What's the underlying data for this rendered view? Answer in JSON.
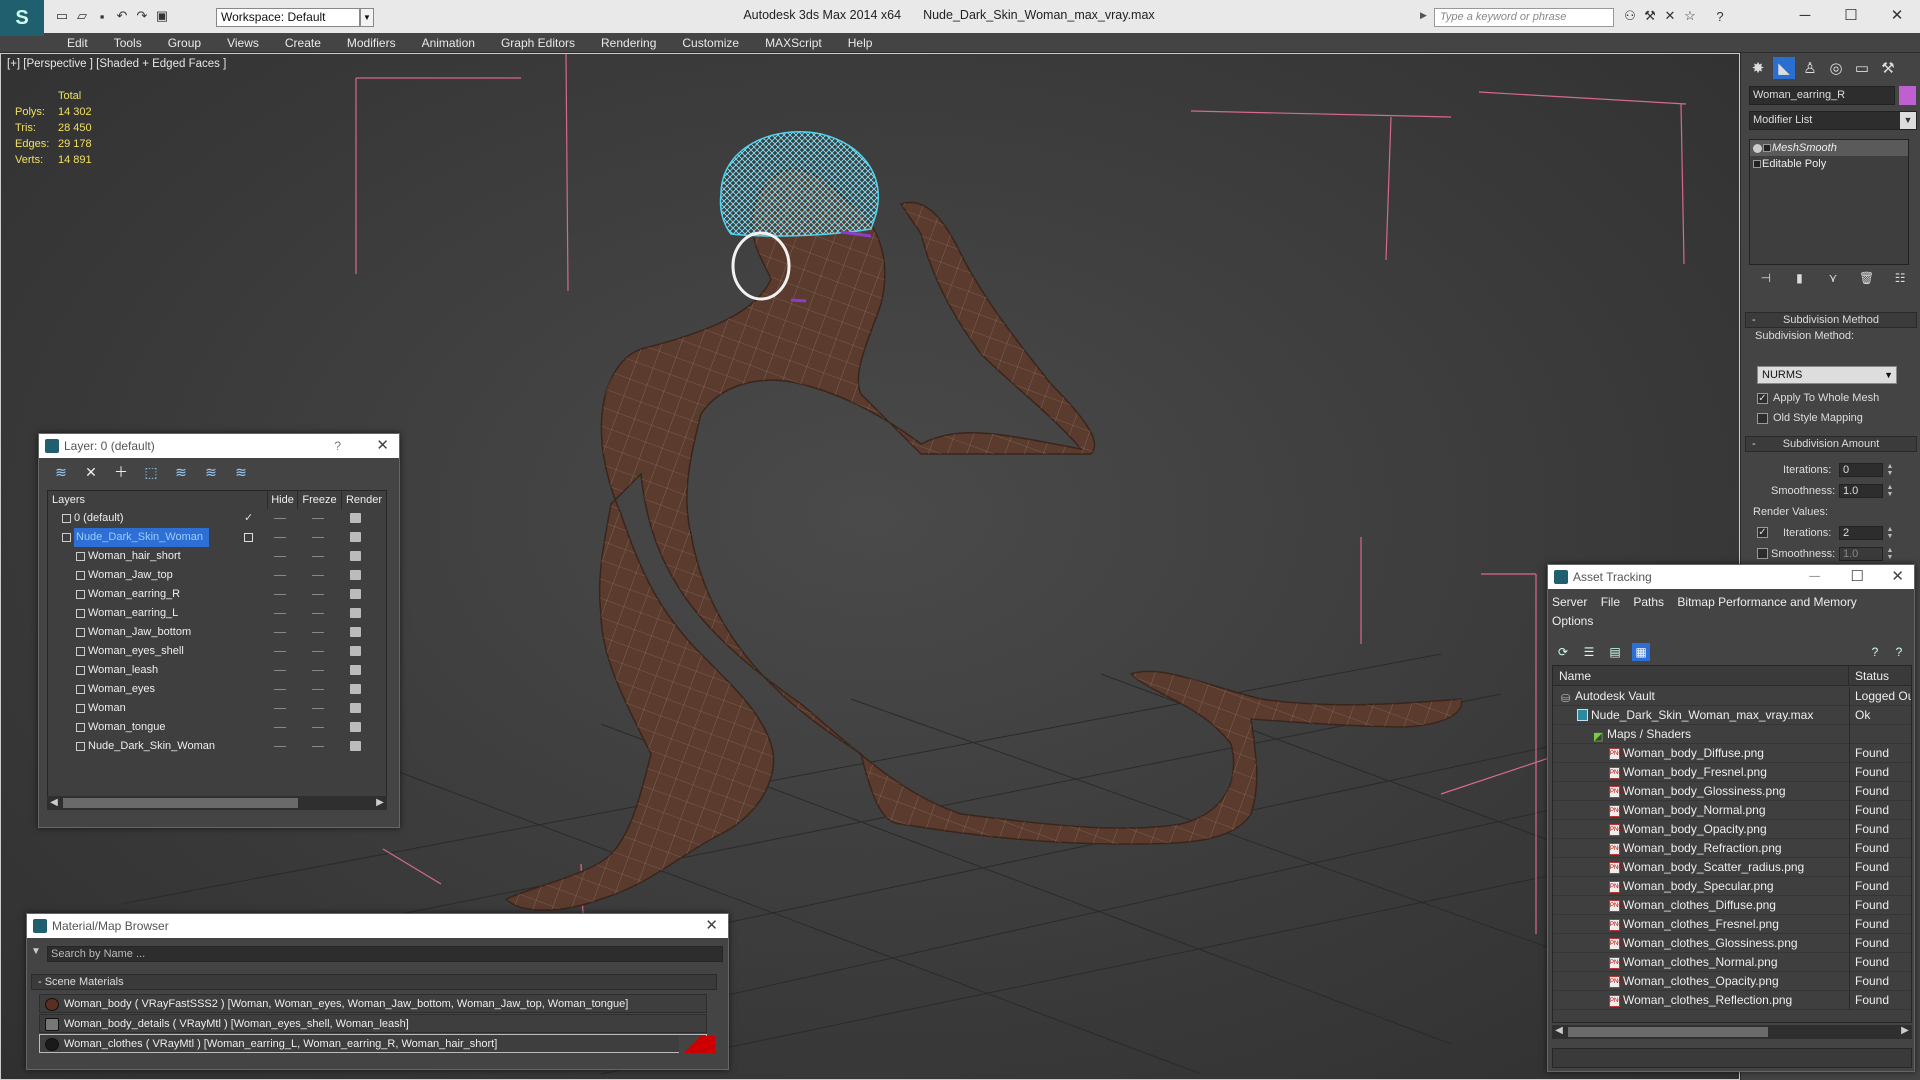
{
  "titlebar": {
    "workspace": "Workspace: Default",
    "app": "Autodesk 3ds Max  2014 x64",
    "file": "Nude_Dark_Skin_Woman_max_vray.max",
    "search_placeholder": "Type a keyword or phrase"
  },
  "menu": [
    "Edit",
    "Tools",
    "Group",
    "Views",
    "Create",
    "Modifiers",
    "Animation",
    "Graph Editors",
    "Rendering",
    "Customize",
    "MAXScript",
    "Help"
  ],
  "viewport": {
    "label": "[+] [Perspective ] [Shaded + Edged Faces ]",
    "stats": {
      "header": "Total",
      "rows": [
        {
          "label": "Polys:",
          "value": "14 302"
        },
        {
          "label": "Tris:",
          "value": "28 450"
        },
        {
          "label": "Edges:",
          "value": "29 178"
        },
        {
          "label": "Verts:",
          "value": "14 891"
        }
      ]
    }
  },
  "command_panel": {
    "object_name": "Woman_earring_R",
    "object_color": "#c060d0",
    "modifier_list": "Modifier List",
    "stack": [
      "MeshSmooth",
      "Editable Poly"
    ],
    "subdivision_method": {
      "title": "Subdivision Method",
      "label": "Subdivision Method:",
      "value": "NURMS",
      "apply_whole_mesh": "Apply To Whole Mesh",
      "old_style": "Old Style Mapping"
    },
    "subdivision_amount": {
      "title": "Subdivision Amount",
      "iterations_label": "Iterations:",
      "iterations": "0",
      "smoothness_label": "Smoothness:",
      "smoothness": "1.0",
      "render_values": "Render Values:",
      "r_iterations_label": "Iterations:",
      "r_iterations": "2",
      "r_smoothness_label": "Smoothness:",
      "r_smoothness": "1.0"
    }
  },
  "layer_window": {
    "title": "Layer: 0 (default)",
    "help": "?",
    "columns": [
      "Layers",
      "Hide",
      "Freeze",
      "Render"
    ],
    "rows": [
      {
        "name": "0 (default)",
        "level": 0
      },
      {
        "name": "Nude_Dark_Skin_Woman",
        "level": 0
      },
      {
        "name": "Woman_hair_short",
        "level": 1
      },
      {
        "name": "Woman_Jaw_top",
        "level": 1
      },
      {
        "name": "Woman_earring_R",
        "level": 1
      },
      {
        "name": "Woman_earring_L",
        "level": 1
      },
      {
        "name": "Woman_Jaw_bottom",
        "level": 1
      },
      {
        "name": "Woman_eyes_shell",
        "level": 1
      },
      {
        "name": "Woman_leash",
        "level": 1
      },
      {
        "name": "Woman_eyes",
        "level": 1
      },
      {
        "name": "Woman",
        "level": 1
      },
      {
        "name": "Woman_tongue",
        "level": 1
      },
      {
        "name": "Nude_Dark_Skin_Woman",
        "level": 1
      }
    ]
  },
  "material_browser": {
    "title": "Material/Map Browser",
    "search_placeholder": "Search by Name ...",
    "group": "- Scene Materials",
    "materials": [
      "Woman_body  ( VRayFastSSS2 ) [Woman, Woman_eyes, Woman_Jaw_bottom, Woman_Jaw_top, Woman_tongue]",
      "Woman_body_details  ( VRayMtl ) [Woman_eyes_shell, Woman_leash]",
      "Woman_clothes  ( VRayMtl ) [Woman_earring_L, Woman_earring_R, Woman_hair_short]"
    ]
  },
  "asset_tracking": {
    "title": "Asset Tracking",
    "menu": [
      "Server",
      "File",
      "Paths",
      "Bitmap Performance and Memory",
      "Options"
    ],
    "columns": [
      "Name",
      "Status"
    ],
    "rows": [
      {
        "name": "Autodesk Vault",
        "status": "Logged Out",
        "level": 0
      },
      {
        "name": "Nude_Dark_Skin_Woman_max_vray.max",
        "status": "Ok",
        "level": 1
      },
      {
        "name": "Maps / Shaders",
        "status": "",
        "level": 2
      },
      {
        "name": "Woman_body_Diffuse.png",
        "status": "Found",
        "level": 3
      },
      {
        "name": "Woman_body_Fresnel.png",
        "status": "Found",
        "level": 3
      },
      {
        "name": "Woman_body_Glossiness.png",
        "status": "Found",
        "level": 3
      },
      {
        "name": "Woman_body_Normal.png",
        "status": "Found",
        "level": 3
      },
      {
        "name": "Woman_body_Opacity.png",
        "status": "Found",
        "level": 3
      },
      {
        "name": "Woman_body_Refraction.png",
        "status": "Found",
        "level": 3
      },
      {
        "name": "Woman_body_Scatter_radius.png",
        "status": "Found",
        "level": 3
      },
      {
        "name": "Woman_body_Specular.png",
        "status": "Found",
        "level": 3
      },
      {
        "name": "Woman_clothes_Diffuse.png",
        "status": "Found",
        "level": 3
      },
      {
        "name": "Woman_clothes_Fresnel.png",
        "status": "Found",
        "level": 3
      },
      {
        "name": "Woman_clothes_Glossiness.png",
        "status": "Found",
        "level": 3
      },
      {
        "name": "Woman_clothes_Normal.png",
        "status": "Found",
        "level": 3
      },
      {
        "name": "Woman_clothes_Opacity.png",
        "status": "Found",
        "level": 3
      },
      {
        "name": "Woman_clothes_Reflection.png",
        "status": "Found",
        "level": 3
      }
    ]
  }
}
